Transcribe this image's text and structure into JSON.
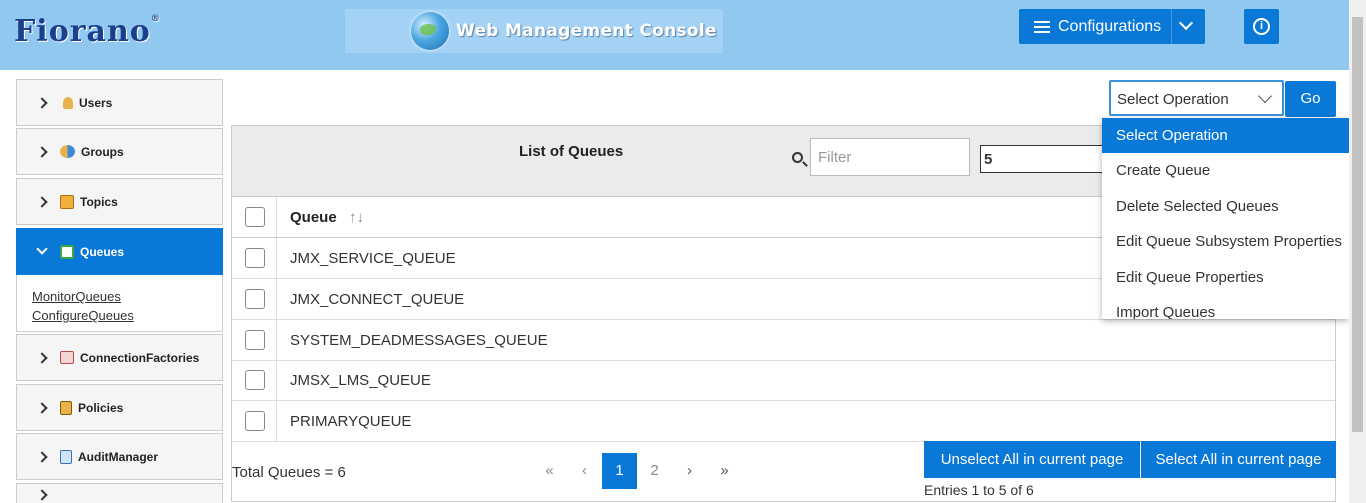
{
  "header": {
    "logo": "Fiorano",
    "logo_mark": "®",
    "console_title": "Web Management Console",
    "config_label": "Configurations"
  },
  "sidebar": {
    "items": [
      {
        "label": "Users"
      },
      {
        "label": "Groups"
      },
      {
        "label": "Topics"
      },
      {
        "label": "Queues"
      },
      {
        "label": "ConnectionFactories"
      },
      {
        "label": "Policies"
      },
      {
        "label": "AuditManager"
      }
    ],
    "queues_links": [
      "MonitorQueues",
      "ConfigureQueues"
    ]
  },
  "operation": {
    "selected": "Select Operation",
    "go_label": "Go",
    "options": [
      "Select Operation",
      "Create Queue",
      "Delete Selected Queues",
      "Edit Queue Subsystem Properties",
      "Edit Queue Properties",
      "Import Queues"
    ]
  },
  "panel": {
    "title": "List of Queues",
    "filter_placeholder": "Filter",
    "page_size": "5",
    "column_header": "Queue",
    "rows": [
      "JMX_SERVICE_QUEUE",
      "JMX_CONNECT_QUEUE",
      "SYSTEM_DEADMESSAGES_QUEUE",
      "JMSX_LMS_QUEUE",
      "PRIMARYQUEUE"
    ],
    "total": "Total Queues = 6",
    "pages": [
      "1",
      "2"
    ],
    "unselect_label": "Unselect All in current page",
    "select_label": "Select All in current page",
    "entries": "Entries 1 to 5 of 6"
  },
  "colors": {
    "header_bg": "#90c8f0",
    "accent": "#0a78d6"
  }
}
